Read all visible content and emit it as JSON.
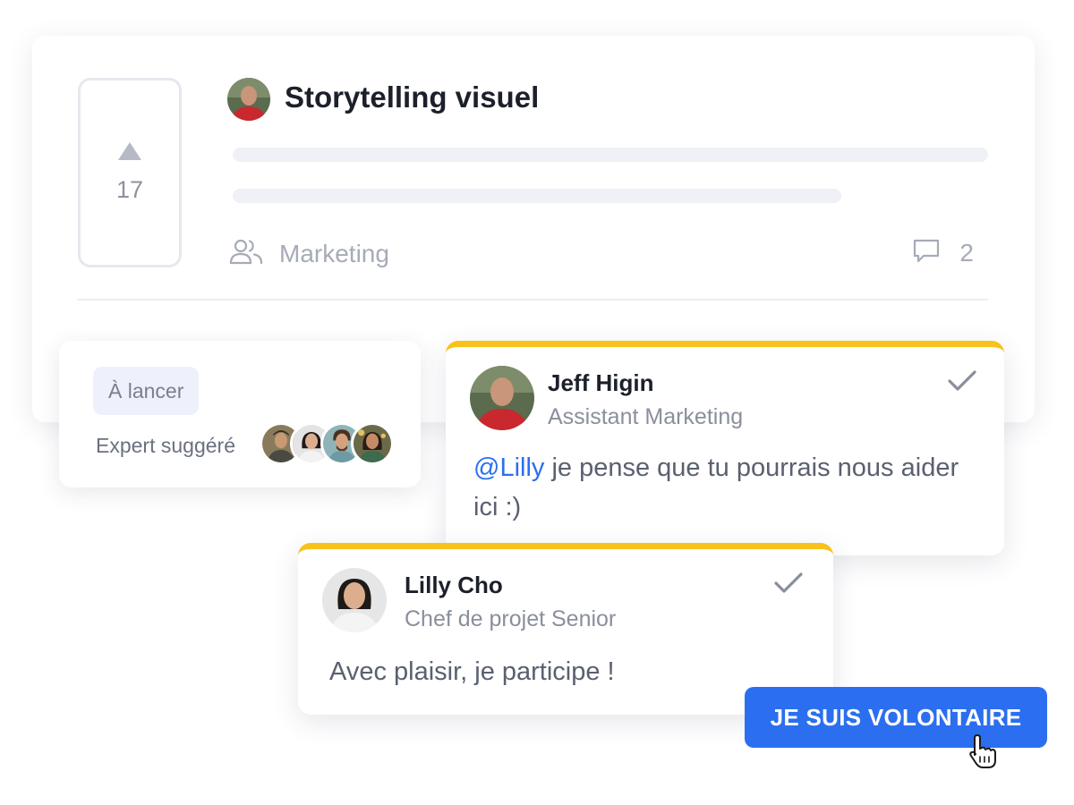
{
  "post": {
    "title": "Storytelling visuel",
    "votes": "17",
    "team": "Marketing",
    "comment_count": "2"
  },
  "status_card": {
    "status": "À lancer",
    "expert_label": "Expert suggéré"
  },
  "comments": [
    {
      "author": "Jeff Higin",
      "role": "Assistant Marketing",
      "mention": "@Lilly",
      "text": " je pense que tu pourrais nous aider ici :)"
    },
    {
      "author": "Lilly Cho",
      "role": "Chef de projet Senior",
      "text": "Avec plaisir, je participe !"
    }
  ],
  "cta": {
    "label": "JE SUIS VOLONTAIRE"
  },
  "icons": {
    "upvote": "upvote-arrow-icon",
    "team": "users-icon",
    "comments": "comment-bubble-icon",
    "check": "checkmark-icon",
    "cursor": "hand-pointer-icon"
  },
  "colors": {
    "accent": "#2b6ff0",
    "comment_stripe": "#f7c21b",
    "badge_bg": "#eef1fb"
  }
}
